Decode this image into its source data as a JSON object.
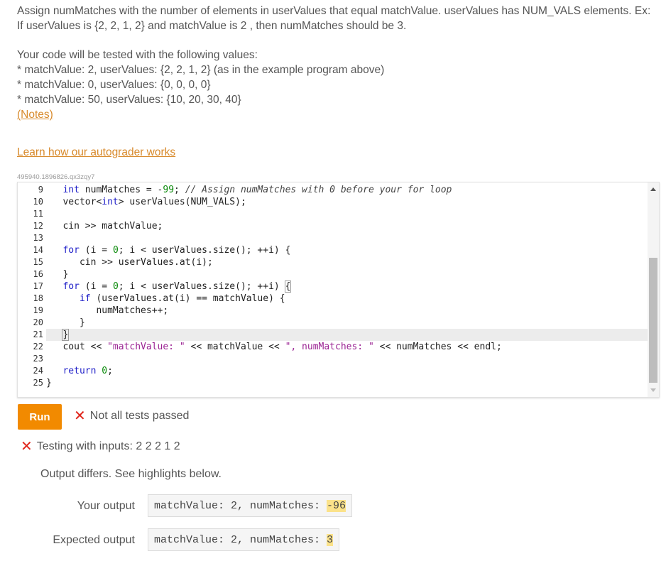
{
  "instructions": {
    "line1": "Assign numMatches with the number of elements in userValues that equal matchValue. userValues has NUM_VALS elements. Ex:",
    "line2": "If userValues is {2, 2, 1, 2} and matchValue is 2 , then numMatches should be 3.",
    "tests_intro": "Your code will be tested with the following values:",
    "test_cases": [
      "* matchValue: 2, userValues: {2, 2, 1, 2} (as in the example program above)",
      "* matchValue: 0, userValues: {0, 0, 0, 0}",
      "* matchValue: 50, userValues: {10, 20, 30, 40}"
    ],
    "notes_link": "(Notes)",
    "learn_link": "Learn how our autograder works"
  },
  "challenge_id": "495940.1896826.qx3zqy7",
  "editor": {
    "line_numbers": [
      "9",
      "10",
      "11",
      "12",
      "13",
      "14",
      "15",
      "16",
      "17",
      "18",
      "19",
      "20",
      "21",
      "22",
      "23",
      "24",
      "25"
    ],
    "lines": [
      "   int numMatches = -99; // Assign numMatches with 0 before your for loop",
      "   vector<int> userValues(NUM_VALS);",
      "",
      "   cin >> matchValue;",
      "",
      "   for (i = 0; i < userValues.size(); ++i) {",
      "      cin >> userValues.at(i);",
      "   }",
      "   for (i = 0; i < userValues.size(); ++i) {",
      "      if (userValues.at(i) == matchValue) {",
      "         numMatches++;",
      "      }",
      "   }",
      "   cout << \"matchValue: \" << matchValue << \", numMatches: \" << numMatches << endl;",
      "",
      "   return 0;",
      "}"
    ]
  },
  "run_button": "Run",
  "result_status": "Not all tests passed",
  "test": {
    "header": "Testing with inputs: 2 2 2 1 2",
    "note": "Output differs. See highlights below.",
    "your_output_label": "Your output",
    "your_output_prefix": "matchValue: 2, numMatches: ",
    "your_output_diff": "-96",
    "expected_output_label": "Expected output",
    "expected_output_prefix": "matchValue: 2, numMatches: ",
    "expected_output_diff": "3"
  },
  "colors": {
    "accent": "#f28a00",
    "link": "#d88a2c",
    "error": "#e0251b",
    "highlight": "#fbe28a"
  },
  "icons": {
    "fail": "x-icon"
  }
}
